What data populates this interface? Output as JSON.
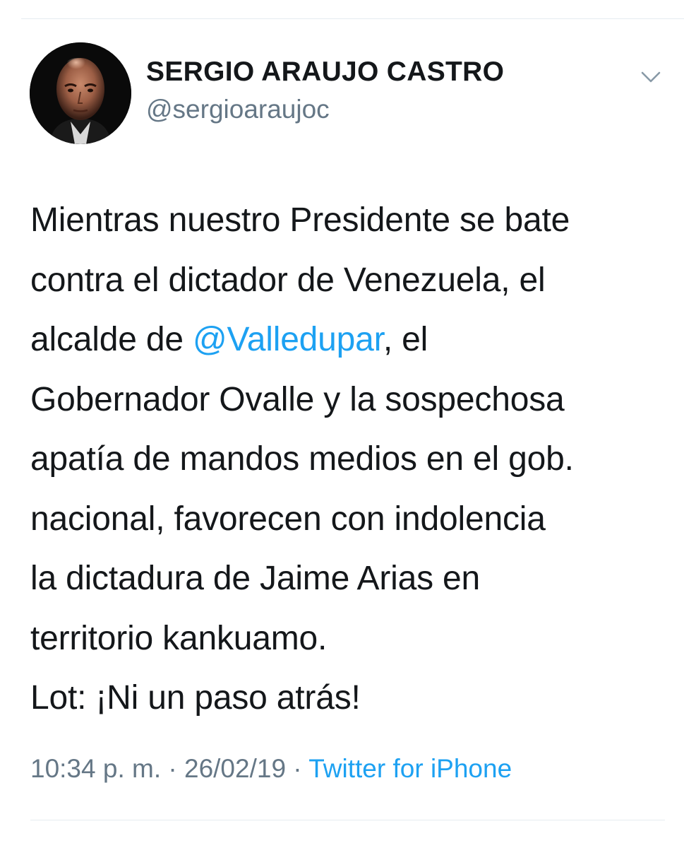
{
  "tweet": {
    "author": {
      "name": "SERGIO ARAUJO CASTRO",
      "handle": "@sergioaraujoc"
    },
    "body": {
      "line1": "Mientras nuestro Presidente se bate",
      "line2": "contra el dictador de Venezuela, el",
      "line3_before": "alcalde de ",
      "line3_mention": "@Valledupar",
      "line3_after": ", el",
      "line4": "Gobernador Ovalle y la sospechosa",
      "line5": "apatía de mandos medios en el gob.",
      "line6": "nacional, favorecen con indolencia",
      "line7": "la dictadura de Jaime Arias en",
      "line8": "territorio kankuamo.",
      "line9": "Lot: ¡Ni un paso atrás!"
    },
    "meta": {
      "time": "10:34 p. m.",
      "separator": " · ",
      "date": "26/02/19",
      "source": "Twitter for iPhone"
    }
  },
  "colors": {
    "text": "#14171a",
    "secondary": "#657786",
    "link": "#1da1f2",
    "divider": "#e6ecf0"
  },
  "icons": {
    "menu": "chevron-down-icon",
    "avatar": "profile-photo"
  }
}
